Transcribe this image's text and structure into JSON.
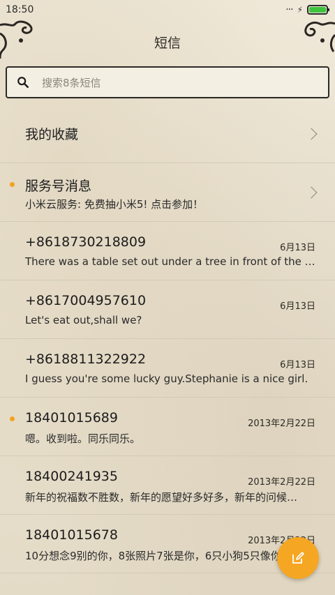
{
  "status_bar": {
    "time": "18:50",
    "battery_color": "#3ec43e"
  },
  "header": {
    "title": "短信"
  },
  "search": {
    "placeholder": "搜索8条短信"
  },
  "favorites": {
    "label": "我的收藏"
  },
  "service": {
    "title": "服务号消息",
    "preview": "小米云服务: 免费抽小米5! 点击参加！",
    "unread": true
  },
  "messages": [
    {
      "name": "+8618730218809",
      "date": "6月13日",
      "preview": "There was a table set out under a tree in front of the ho…",
      "unread": false
    },
    {
      "name": "+8617004957610",
      "date": "6月13日",
      "preview": "Let's eat out,shall we?",
      "unread": false
    },
    {
      "name": "+8618811322922",
      "date": "6月13日",
      "preview": "I guess you're some lucky guy.Stephanie is a nice girl.",
      "unread": false
    },
    {
      "name": "18401015689",
      "date": "2013年2月22日",
      "preview": "嗯。收到啦。同乐同乐。",
      "unread": true
    },
    {
      "name": "18400241935",
      "date": "2013年2月22日",
      "preview": "新年的祝福数不胜数，新年的愿望好多好多，新年的问候…",
      "unread": false
    },
    {
      "name": "18401015678",
      "date": "2013年2月22日",
      "preview": "10分想念9别的你，8张照片7张是你，6只小狗5只像你…",
      "unread": false
    }
  ],
  "colors": {
    "accent": "#f5a623",
    "unread_dot": "#f3a21f",
    "background": "#ece4d3"
  },
  "icons": {
    "search": "search-icon",
    "compose": "compose-icon",
    "chevron": "chevron-right-icon"
  }
}
